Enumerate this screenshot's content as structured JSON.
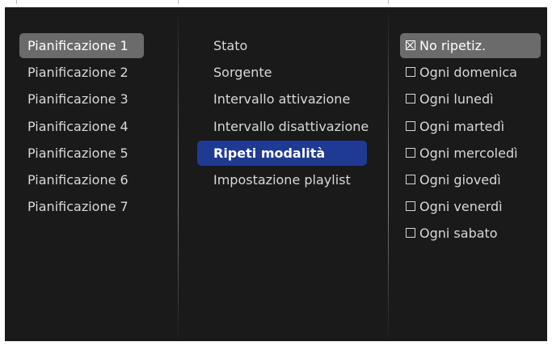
{
  "schedules": [
    {
      "label": "Pianificazione 1"
    },
    {
      "label": "Pianificazione 2"
    },
    {
      "label": "Pianificazione 3"
    },
    {
      "label": "Pianificazione 4"
    },
    {
      "label": "Pianificazione 5"
    },
    {
      "label": "Pianificazione 6"
    },
    {
      "label": "Pianificazione 7"
    }
  ],
  "settings": [
    {
      "label": "Stato"
    },
    {
      "label": "Sorgente"
    },
    {
      "label": "Intervallo attivazione"
    },
    {
      "label": "Intervallo disattivazione"
    },
    {
      "label": "Ripeti modalità"
    },
    {
      "label": "Impostazione playlist"
    }
  ],
  "repeat_options": [
    {
      "label": "No ripetiz.",
      "checked": true
    },
    {
      "label": "Ogni domenica",
      "checked": false
    },
    {
      "label": "Ogni lunedì",
      "checked": false
    },
    {
      "label": "Ogni martedì",
      "checked": false
    },
    {
      "label": "Ogni mercoledì",
      "checked": false
    },
    {
      "label": "Ogni giovedì",
      "checked": false
    },
    {
      "label": "Ogni venerdì",
      "checked": false
    },
    {
      "label": "Ogni sabato",
      "checked": false
    }
  ],
  "colors": {
    "highlight_grey": "#6b6b6b",
    "highlight_blue": "#1f3a93",
    "background": "#1a1a1a"
  }
}
